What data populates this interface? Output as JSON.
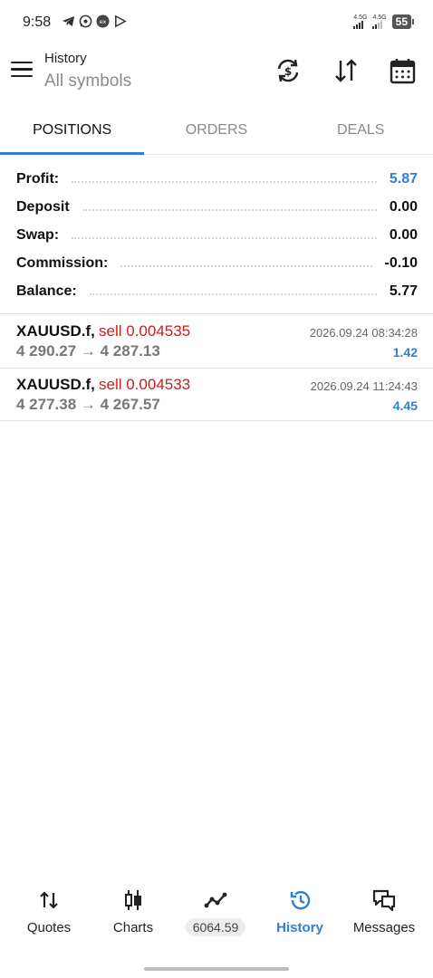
{
  "status_bar": {
    "time": "9:58",
    "sim1_label": "4.5G",
    "sim2_label": "4.5G",
    "battery": "55",
    "icons": [
      "telegram-icon",
      "whatsapp-icon",
      "ex-icon",
      "play-icon"
    ]
  },
  "app_bar": {
    "title": "History",
    "subtitle": "All symbols",
    "actions": [
      "currency-exchange-icon",
      "sort-icon",
      "calendar-icon"
    ]
  },
  "tabs": [
    {
      "label": "POSITIONS",
      "active": true
    },
    {
      "label": "ORDERS",
      "active": false
    },
    {
      "label": "DEALS",
      "active": false
    }
  ],
  "summary": [
    {
      "label": "Profit:",
      "value": "5.87",
      "color": "#2f7fd8"
    },
    {
      "label": "Deposit",
      "value": "0.00"
    },
    {
      "label": "Swap:",
      "value": "0.00"
    },
    {
      "label": "Commission:",
      "value": "-0.10"
    },
    {
      "label": "Balance:",
      "value": "5.77"
    }
  ],
  "deals": [
    {
      "symbol": "XAUUSD.f,",
      "side": "sell 0.004535",
      "prices": "4 290.27 → 4 287.13",
      "time": "2026.09.24 08:34:28",
      "profit": "1.42"
    },
    {
      "symbol": "XAUUSD.f,",
      "side": "sell 0.004533",
      "prices": "4 277.38 → 4 267.57",
      "time": "2026.09.24 11:24:43",
      "profit": "4.45"
    }
  ],
  "bottom_nav": [
    {
      "label": "Quotes",
      "icon": "quotes-icon",
      "active": false
    },
    {
      "label": "Charts",
      "icon": "charts-icon",
      "active": false
    },
    {
      "label": "6064.59",
      "icon": "trade-icon",
      "active": false
    },
    {
      "label": "History",
      "icon": "history-icon",
      "active": true
    },
    {
      "label": "Messages",
      "icon": "messages-icon",
      "active": false
    }
  ],
  "colors": {
    "accent": "#2f7fd8",
    "sell": "#c41e1e"
  }
}
